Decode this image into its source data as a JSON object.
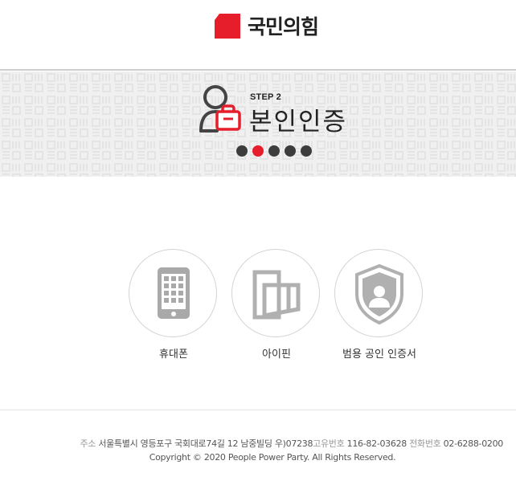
{
  "header": {
    "logo_text": "국민의힘",
    "logo_color": "#e61e2b"
  },
  "step": {
    "label": "STEP 2",
    "title": "본인인증",
    "total_steps": 5,
    "current_step": 2,
    "active_color": "#e61e2b",
    "inactive_color": "#3d3d3d"
  },
  "auth_options": [
    {
      "label": "휴대폰",
      "icon": "mobile-phone-icon"
    },
    {
      "label": "아이핀",
      "icon": "ipin-icon"
    },
    {
      "label": "범용 공인 인증서",
      "icon": "certificate-shield-icon"
    }
  ],
  "footer": {
    "address_prefix": "주소",
    "address": "서울특별시 영등포구 국회대로74길 12 남중빌딩 우)07238",
    "reg_label": "고유번호",
    "reg_number": "116-82-03628",
    "phone_label": "전화번호",
    "phone": "02-6288-0200",
    "copyright": "Copyright © 2020 People Power Party. All Rights Reserved."
  }
}
